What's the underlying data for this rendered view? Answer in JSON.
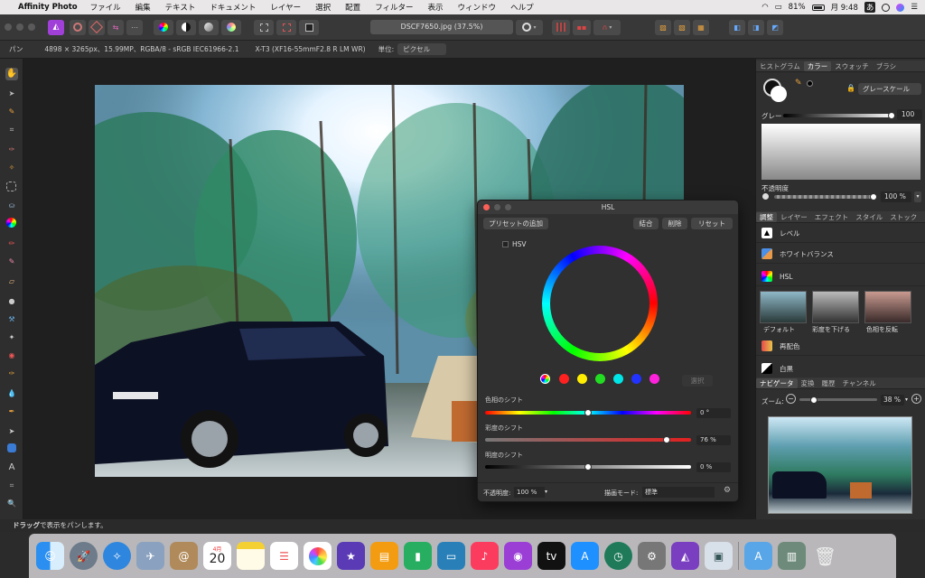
{
  "menubar": {
    "app": "Affinity Photo",
    "items": [
      "ファイル",
      "編集",
      "テキスト",
      "ドキュメント",
      "レイヤー",
      "選択",
      "配置",
      "フィルター",
      "表示",
      "ウィンドウ",
      "ヘルプ"
    ],
    "battery": "81%",
    "time": "月 9:48",
    "input": "あ"
  },
  "toolbar": {
    "document_title": "DSCF7650.jpg (37.5%)"
  },
  "context": {
    "tool": "パン",
    "info": "4898 × 3265px、15.99MP、RGBA/8 - sRGB IEC61966-2.1",
    "camera": "X-T3 (XF16-55mmF2.8 R LM WR)",
    "unit_label": "単位:",
    "unit_value": "ピクセル"
  },
  "color_panel": {
    "tabs": [
      "ヒストグラム",
      "カラー",
      "スウォッチ",
      "ブラシ"
    ],
    "active_tab": "カラー",
    "mode": "グレースケール",
    "gray_label": "グレー",
    "gray_value": "100",
    "opacity_label": "不透明度",
    "opacity_value": "100 %"
  },
  "adjust_panel": {
    "tabs": [
      "調整",
      "レイヤー",
      "エフェクト",
      "スタイル",
      "ストック"
    ],
    "active_tab": "調整",
    "items": [
      "レベル",
      "ホワイトバランス",
      "HSL",
      "再配色",
      "白黒"
    ],
    "presets": [
      "デフォルト",
      "彩度を下げる",
      "色相を反転"
    ]
  },
  "navigator": {
    "tabs": [
      "ナビゲータ",
      "変換",
      "履歴",
      "チャンネル"
    ],
    "active_tab": "ナビゲータ",
    "zoom_label": "ズーム:",
    "zoom_value": "38 %",
    "zoom_level": 0.38
  },
  "hsl": {
    "title": "HSL",
    "add_preset": "プリセットの追加",
    "merge": "結合",
    "delete": "削除",
    "reset": "リセット",
    "hsv_label": "HSV",
    "select": "選択",
    "hue_label": "色相のシフト",
    "hue_value": "0 °",
    "sat_label": "彩度のシフト",
    "sat_value": "76 %",
    "light_label": "明度のシフト",
    "light_value": "0 %",
    "opacity_label": "不透明度:",
    "opacity_value": "100 %",
    "blend_label": "描画モード:",
    "blend_value": "標準"
  },
  "status": {
    "bold": "ドラッグ",
    "text": "で表示をパンします。"
  },
  "dock": {
    "calendar_month": "4月",
    "calendar_day": "20"
  },
  "colors": {
    "accent": "#b040e0",
    "swatches": [
      "#ff2020",
      "#ffee00",
      "#22dd22",
      "#00e5e5",
      "#2233ff",
      "#ff22dd"
    ]
  }
}
